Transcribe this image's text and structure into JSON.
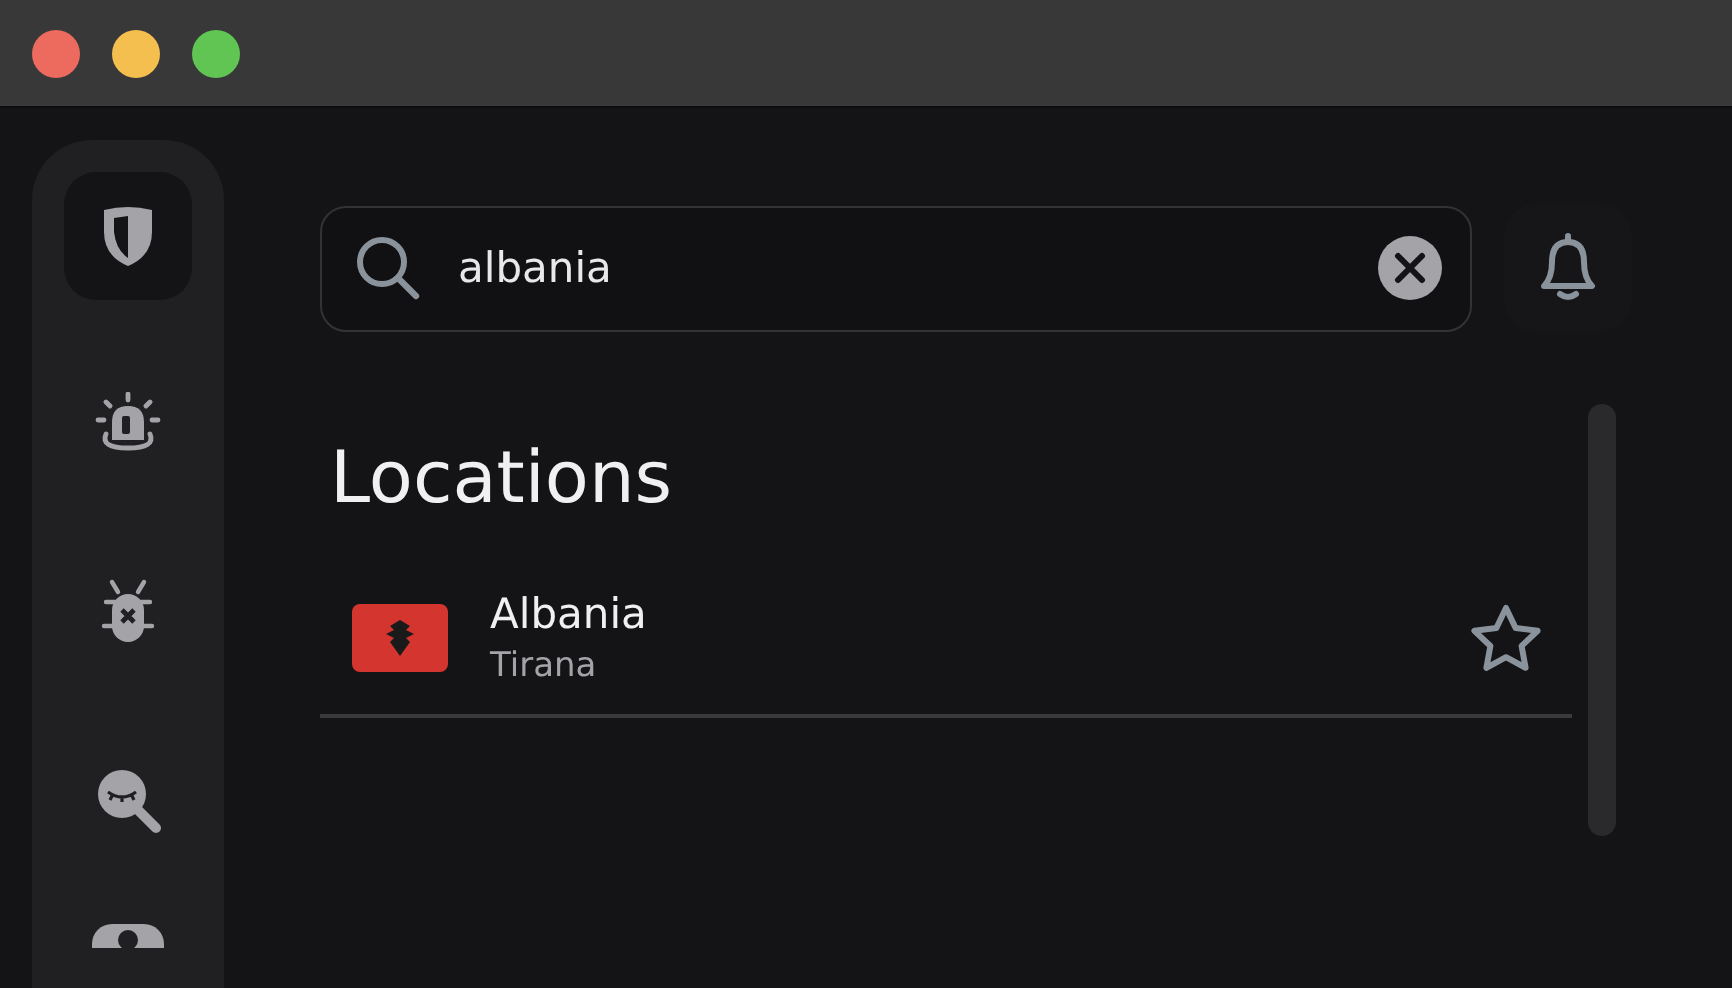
{
  "sidebar": {
    "items": [
      {
        "kind": "shield",
        "selected": true
      },
      {
        "kind": "alarm",
        "selected": false
      },
      {
        "kind": "bug",
        "selected": false
      },
      {
        "kind": "eye-search",
        "selected": false
      },
      {
        "kind": "partial",
        "selected": false
      }
    ]
  },
  "search": {
    "value": "albania"
  },
  "heading": "Locations",
  "locations": [
    {
      "name": "Albania",
      "city": "Tirana",
      "favorite": false
    }
  ]
}
